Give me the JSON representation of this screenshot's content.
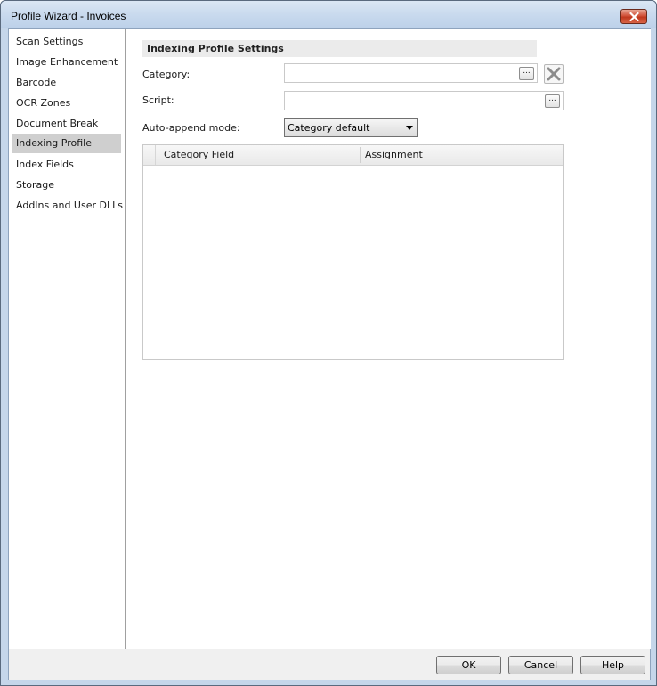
{
  "window": {
    "title": "Profile Wizard - Invoices"
  },
  "sidebar": {
    "items": [
      {
        "label": "Scan Settings",
        "selected": false
      },
      {
        "label": "Image Enhancement",
        "selected": false
      },
      {
        "label": "Barcode",
        "selected": false
      },
      {
        "label": "OCR Zones",
        "selected": false
      },
      {
        "label": "Document Break",
        "selected": false
      },
      {
        "label": "Indexing Profile",
        "selected": true
      },
      {
        "label": "Index Fields",
        "selected": false
      },
      {
        "label": "Storage",
        "selected": false
      },
      {
        "label": "AddIns and User DLLs",
        "selected": false
      }
    ]
  },
  "main": {
    "section_title": "Indexing Profile Settings",
    "category": {
      "label": "Category:",
      "value": ""
    },
    "script": {
      "label": "Script:",
      "value": ""
    },
    "auto_append": {
      "label": "Auto-append mode:",
      "selected": "Category default"
    },
    "browse_label": "...",
    "grid": {
      "columns": [
        "Category Field",
        "Assignment"
      ],
      "rows": []
    }
  },
  "footer": {
    "ok": "OK",
    "cancel": "Cancel",
    "help": "Help"
  }
}
